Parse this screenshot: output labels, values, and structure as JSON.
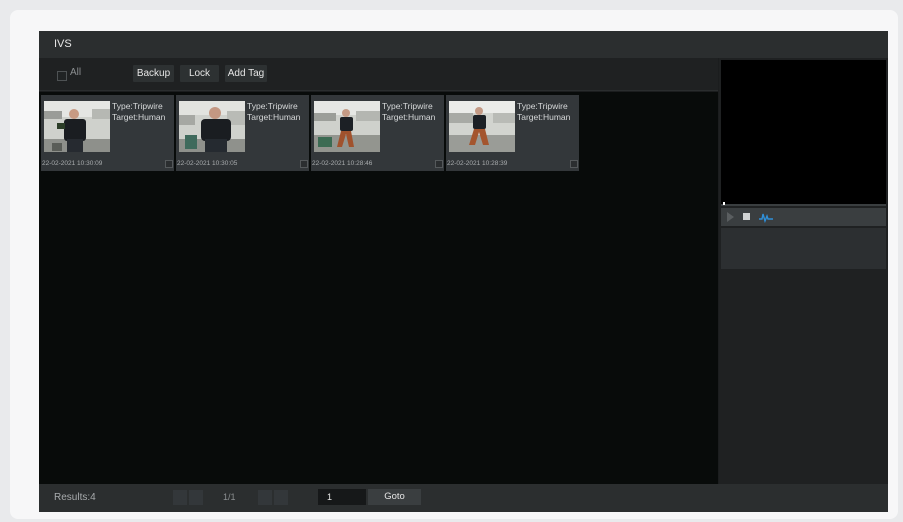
{
  "window": {
    "title": "IVS"
  },
  "toolbar": {
    "all_label": "All",
    "backup_label": "Backup",
    "lock_label": "Lock",
    "add_tag_label": "Add Tag"
  },
  "records": [
    {
      "type": "Type:Tripwire",
      "target": "Target:Human",
      "time": "22-02-2021 10:30:09"
    },
    {
      "type": "Type:Tripwire",
      "target": "Target:Human",
      "time": "22-02-2021 10:30:05"
    },
    {
      "type": "Type:Tripwire",
      "target": "Target:Human",
      "time": "22-02-2021 10:28:46"
    },
    {
      "type": "Type:Tripwire",
      "target": "Target:Human",
      "time": "22-02-2021 10:28:39"
    }
  ],
  "player": {
    "play_icon": "play-icon",
    "stop_icon": "stop-icon",
    "clip_icon": "clip-icon",
    "accent": "#2f8fd8"
  },
  "footer": {
    "results": "Results:4",
    "page_info": "1/1",
    "page_input_value": "1",
    "goto_label": "Goto"
  }
}
